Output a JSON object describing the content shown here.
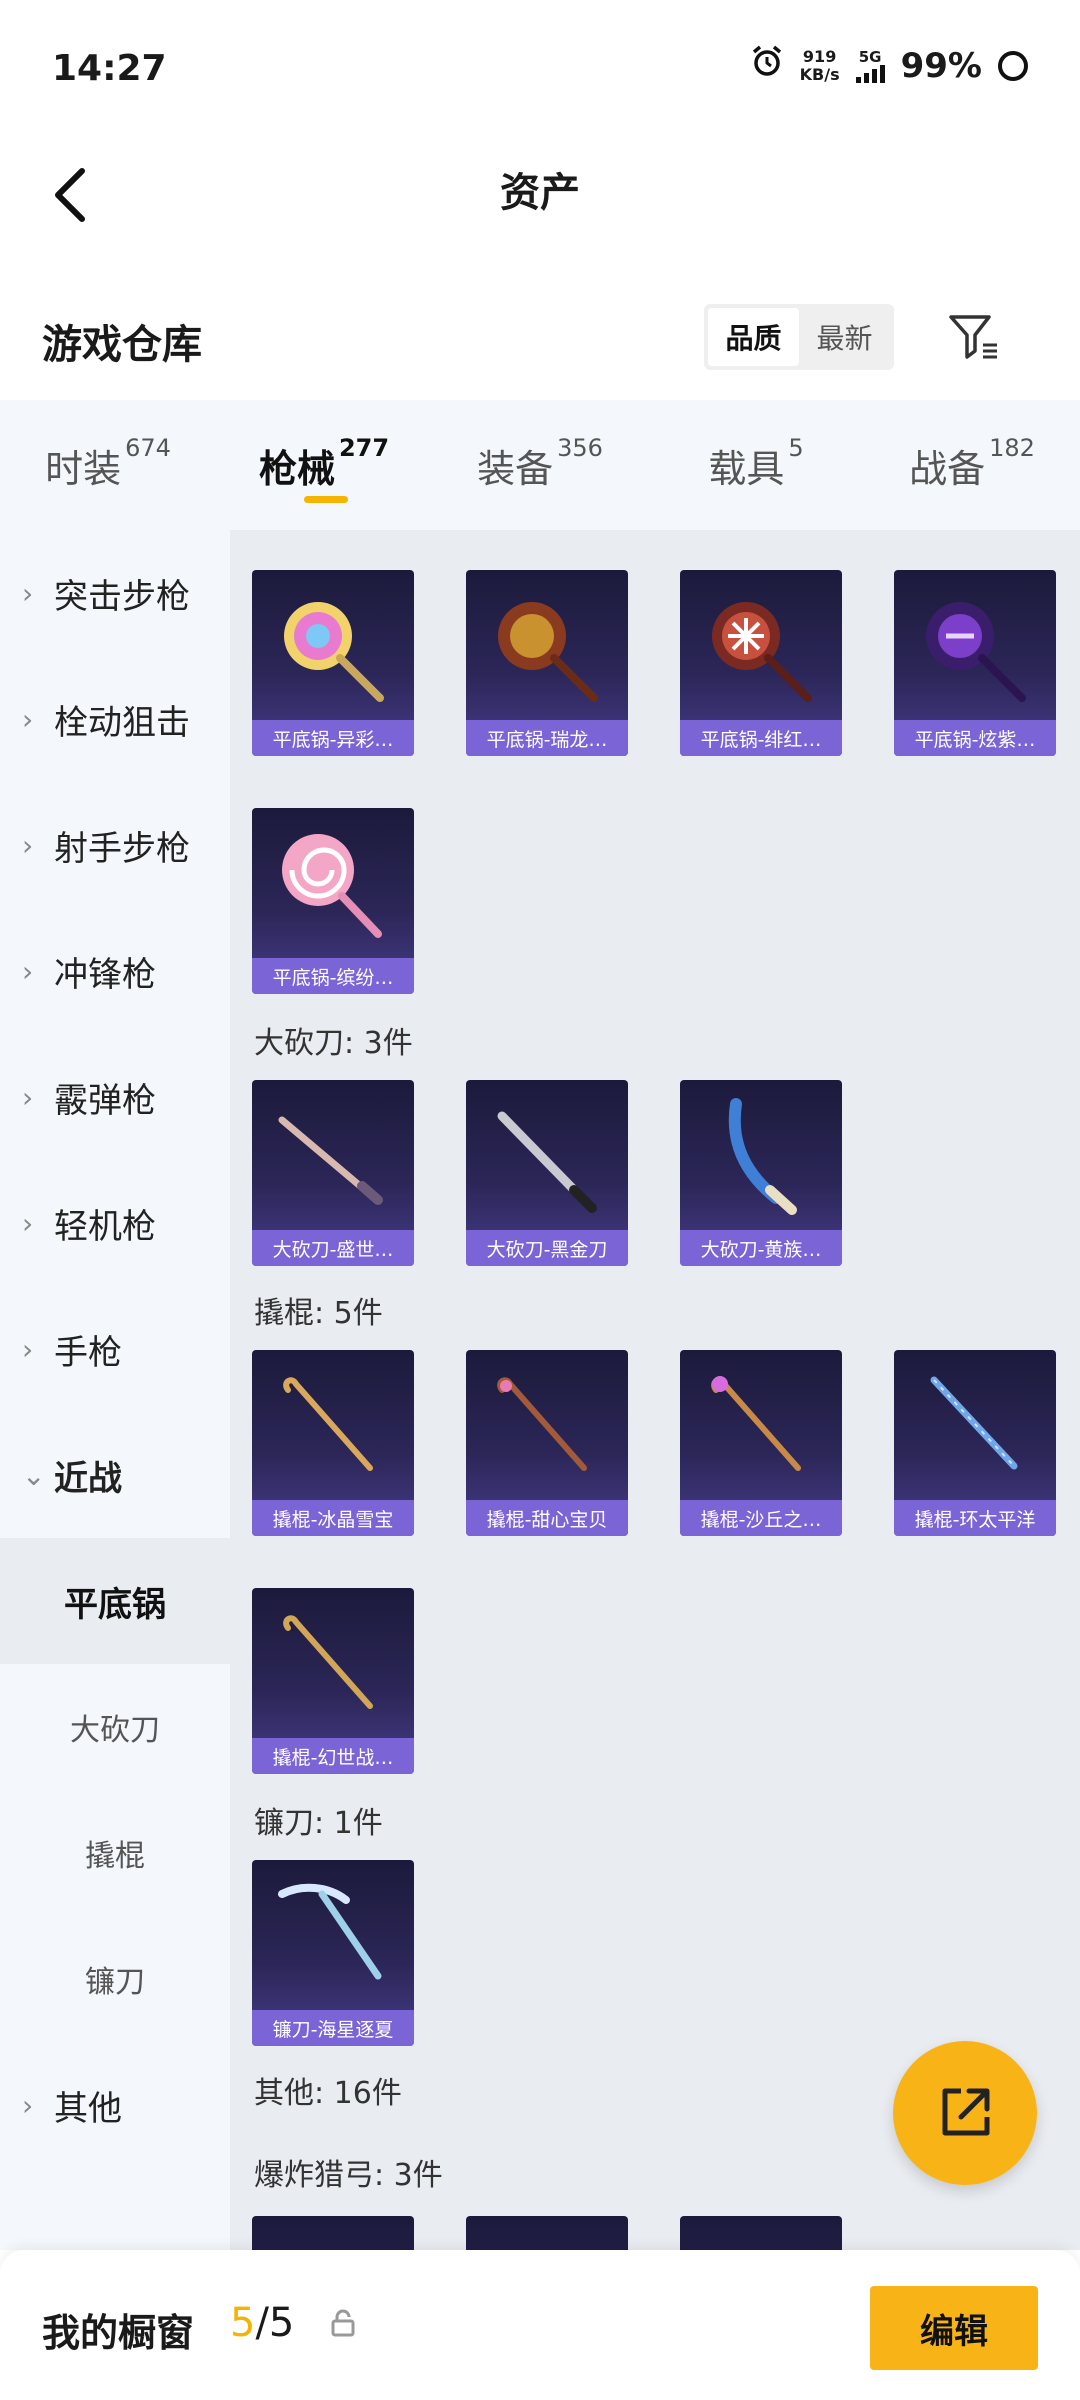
{
  "status_bar": {
    "time": "14:27",
    "net_speed_value": "919",
    "net_speed_unit": "KB/s",
    "network": "5G",
    "battery": "99%"
  },
  "header": {
    "title": "资产"
  },
  "section": {
    "title": "游戏仓库",
    "sort_options": [
      "品质",
      "最新"
    ]
  },
  "tabs": [
    {
      "label": "时装",
      "count": "674"
    },
    {
      "label": "枪械",
      "count": "277"
    },
    {
      "label": "装备",
      "count": "356"
    },
    {
      "label": "载具",
      "count": "5"
    },
    {
      "label": "战备",
      "count": "182"
    }
  ],
  "sidebar": {
    "categories": [
      "突击步枪",
      "栓动狙击",
      "射手步枪",
      "冲锋枪",
      "霰弹枪",
      "轻机枪",
      "手枪",
      "近战"
    ],
    "melee_subs": [
      "平底锅",
      "大砍刀",
      "撬棍",
      "镰刀"
    ],
    "other": "其他"
  },
  "content": {
    "pan_items": [
      "平底锅-异彩…",
      "平底锅-瑞龙…",
      "平底锅-绯红…",
      "平底锅-炫紫…",
      "平底锅-缤纷…"
    ],
    "machete_label": "大砍刀: 3件",
    "machete_items": [
      "大砍刀-盛世…",
      "大砍刀-黑金刀",
      "大砍刀-黄族…"
    ],
    "crowbar_label": "撬棍: 5件",
    "crowbar_items": [
      "撬棍-冰晶雪宝",
      "撬棍-甜心宝贝",
      "撬棍-沙丘之…",
      "撬棍-环太平洋",
      "撬棍-幻世战…"
    ],
    "sickle_label": "镰刀: 1件",
    "sickle_items": [
      "镰刀-海星逐夏"
    ],
    "other_label": "其他: 16件",
    "crossbow_label": "爆炸猎弓: 3件"
  },
  "bottom_bar": {
    "label": "我的橱窗",
    "current": "5",
    "total": "/5",
    "edit": "编辑"
  },
  "colors": {
    "accent": "#f8b417",
    "card_label": "#7b64d6"
  }
}
